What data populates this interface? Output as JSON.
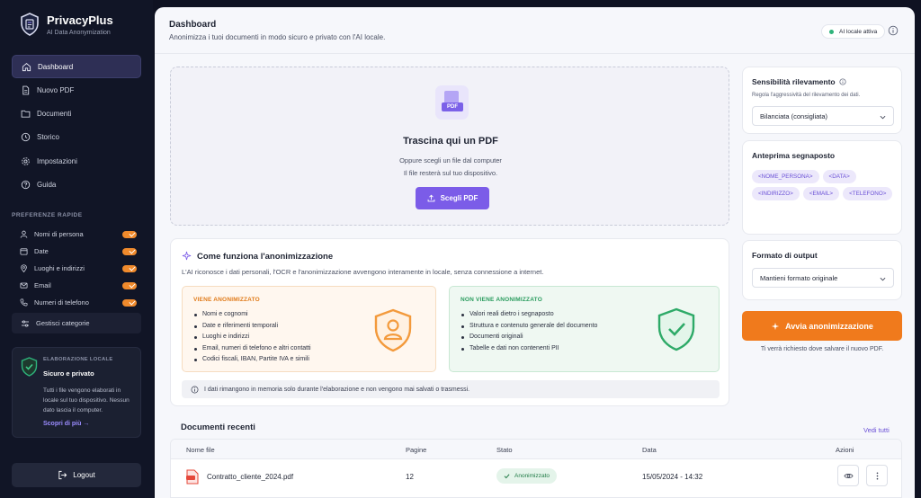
{
  "brand": {
    "name": "PrivacyPlus",
    "subtitle": "AI Data Anonymization"
  },
  "nav": [
    {
      "label": "Dashboard",
      "icon": "home-icon",
      "active": true
    },
    {
      "label": "Nuovo PDF",
      "icon": "file-icon"
    },
    {
      "label": "Documenti",
      "icon": "folder-icon"
    },
    {
      "label": "Storico",
      "icon": "clock-icon"
    },
    {
      "label": "Impostazioni",
      "icon": "gear-icon"
    },
    {
      "label": "Guida",
      "icon": "help-icon"
    }
  ],
  "quick_prefs": {
    "title": "PREFERENZE RAPIDE",
    "items": [
      {
        "label": "Nomi di persona",
        "icon": "user-icon",
        "enabled": true
      },
      {
        "label": "Date",
        "icon": "calendar-icon",
        "enabled": true
      },
      {
        "label": "Luoghi e indirizzi",
        "icon": "pin-icon",
        "enabled": true
      },
      {
        "label": "Email",
        "icon": "mail-icon",
        "enabled": true
      },
      {
        "label": "Numeri di telefono",
        "icon": "phone-icon",
        "enabled": true
      }
    ],
    "manage_label": "Gestisci categorie"
  },
  "local_card": {
    "title": "ELABORAZIONE LOCALE",
    "heading": "Sicuro e privato",
    "body": "Tutti i file vengono elaborati in locale sul tuo dispositivo. Nessun dato lascia il computer.",
    "link": "Scopri di più →"
  },
  "logout_label": "Logout",
  "header": {
    "title": "Dashboard",
    "subtitle": "Anonimizza i tuoi documenti in modo sicuro e privato con l'AI locale.",
    "ai_badge": "AI locale attiva"
  },
  "upload": {
    "badge": "PDF",
    "title": "Trascina qui un PDF",
    "line1": "Oppure scegli un file dal computer",
    "line2": "Il file resterà sul tuo dispositivo.",
    "button": "Scegli PDF"
  },
  "how": {
    "title": "Come funziona l'anonimizzazione",
    "desc": "L'AI riconosce i dati personali, l'OCR e l'anonimizzazione avvengono interamente in locale, senza connessione a internet.",
    "anon": {
      "title": "VIENE ANONIMIZZATO",
      "items": [
        "Nomi e cognomi",
        "Date e riferimenti temporali",
        "Luoghi e indirizzi",
        "Email, numeri di telefono e altri contatti",
        "Codici fiscali, IBAN, Partite IVA e simili"
      ]
    },
    "not_anon": {
      "title": "NON VIENE ANONIMIZZATO",
      "items": [
        "Valori reali dietro i segnaposto",
        "Struttura e contenuto generale del documento",
        "Documenti originali",
        "Tabelle e dati non contenenti PII"
      ]
    },
    "note": "I dati rimangono in memoria solo durante l'elaborazione e non vengono mai salvati o trasmessi."
  },
  "sensitivity": {
    "title": "Sensibilità rilevamento",
    "subtitle": "Regola l'aggressività del rilevamento dei dati.",
    "value": "Bilanciata (consigliata)"
  },
  "placeholders": {
    "title": "Anteprima segnaposto",
    "tags": [
      "<NOME_PERSONA>",
      "<DATA>",
      "<INDIRIZZO>",
      "<EMAIL>",
      "<TELEFONO>"
    ]
  },
  "output": {
    "title": "Formato di output",
    "value": "Mantieni formato originale"
  },
  "start": {
    "button": "Avvia anonimizzazione",
    "note": "Ti verrà richiesto dove salvare il nuovo PDF."
  },
  "recent": {
    "title": "Documenti recenti",
    "see_all": "Vedi tutti",
    "columns": [
      "Nome file",
      "Pagine",
      "Stato",
      "Data",
      "Azioni"
    ],
    "rows": [
      {
        "name": "Contratto_cliente_2024.pdf",
        "pages": "12",
        "status": "Anonimizzato",
        "date": "15/05/2024 - 14:32"
      }
    ]
  },
  "colors": {
    "accent": "#7b5ce8",
    "orange": "#f07a1c",
    "green": "#2eb37b",
    "sidebar": "#111526"
  }
}
